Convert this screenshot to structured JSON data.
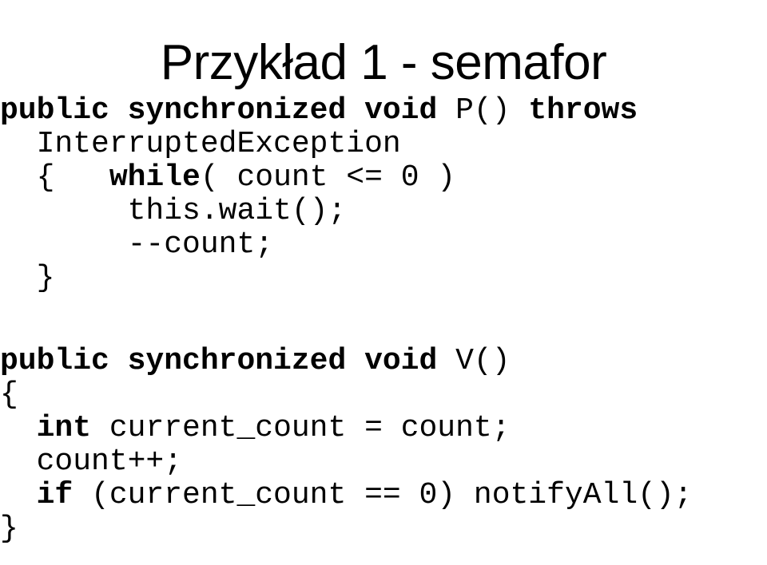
{
  "slide": {
    "title": "Przykład 1 - semafor",
    "background_color": "#ffffff",
    "text_color": "#000000"
  },
  "code": {
    "language": "java",
    "blocks": [
      {
        "name": "method-p",
        "lines": [
          {
            "id": "p-signature",
            "text": "public synchronized void P() throws",
            "tokens": [
              {
                "text": "public synchronized void ",
                "bold": true
              },
              {
                "text": "P() ",
                "bold": false
              },
              {
                "text": "throws",
                "bold": true
              }
            ]
          },
          {
            "id": "p-exception",
            "text": "  InterruptedException",
            "tokens": [
              {
                "text": "  InterruptedException",
                "bold": false
              }
            ]
          },
          {
            "id": "p-open-brace-while",
            "text": "  {   while( count <= 0 )",
            "tokens": [
              {
                "text": "  {   ",
                "bold": false
              },
              {
                "text": "while",
                "bold": true
              },
              {
                "text": "( count <= 0 )",
                "bold": false
              }
            ]
          },
          {
            "id": "p-wait",
            "text": "       this.wait();",
            "tokens": [
              {
                "text": "       this.wait();",
                "bold": false
              }
            ]
          },
          {
            "id": "p-decrement",
            "text": "       --count;",
            "tokens": [
              {
                "text": "       --count;",
                "bold": false
              }
            ]
          },
          {
            "id": "p-close-brace",
            "text": "  }",
            "tokens": [
              {
                "text": "  }",
                "bold": false
              }
            ]
          }
        ]
      },
      {
        "name": "method-v",
        "lines": [
          {
            "id": "v-signature",
            "text": "public synchronized void V()",
            "tokens": [
              {
                "text": "public synchronized void ",
                "bold": true
              },
              {
                "text": "V()",
                "bold": false
              }
            ]
          },
          {
            "id": "v-open-brace",
            "text": "{",
            "tokens": [
              {
                "text": "{",
                "bold": false
              }
            ]
          },
          {
            "id": "v-int-current-count",
            "text": "  int current_count = count;",
            "tokens": [
              {
                "text": "  ",
                "bold": false
              },
              {
                "text": "int",
                "bold": true
              },
              {
                "text": " current_count = count;",
                "bold": false
              }
            ]
          },
          {
            "id": "v-increment",
            "text": "  count++;",
            "tokens": [
              {
                "text": "  count++;",
                "bold": false
              }
            ]
          },
          {
            "id": "v-if-notifyall",
            "text": "  if (current_count == 0) notifyAll();",
            "tokens": [
              {
                "text": "  ",
                "bold": false
              },
              {
                "text": "if",
                "bold": true
              },
              {
                "text": " (current_count == 0) notifyAll();",
                "bold": false
              }
            ]
          },
          {
            "id": "v-close-brace",
            "text": "}",
            "tokens": [
              {
                "text": "}",
                "bold": false
              }
            ]
          }
        ]
      }
    ]
  }
}
